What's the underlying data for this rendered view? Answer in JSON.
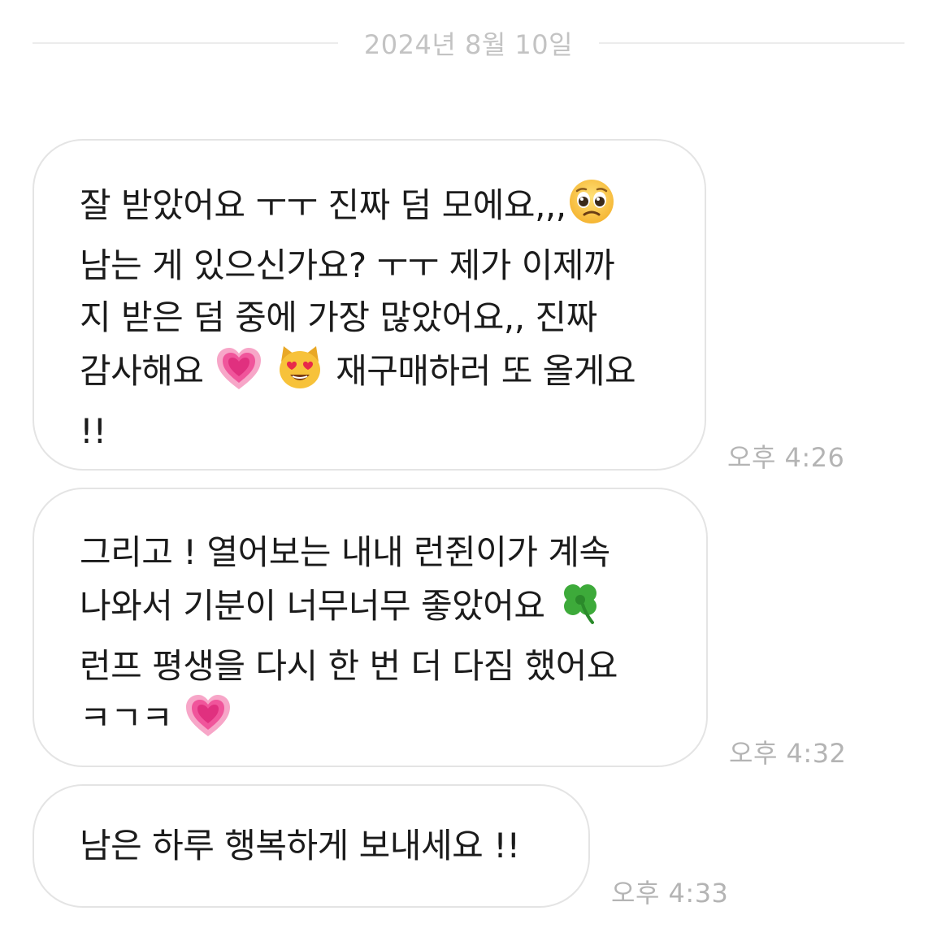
{
  "date_divider": "2024년 8월 10일",
  "messages": [
    {
      "lines": {
        "l1": "잘 받았어요 ㅜㅜ 진짜 덤 모에요,,,",
        "l2": "남는 게 있으신가요? ㅜㅜ 제가 이제까",
        "l3": "지 받은 덤 중에 가장 많았어요,, 진짜",
        "l4a": "감사해요",
        "l4b": "재구매하러 또 올게요",
        "l5": "!!"
      },
      "emojis": [
        "pleading-face",
        "growing-heart",
        "heart-eyes-cat"
      ],
      "time": "오후 4:26"
    },
    {
      "lines": {
        "l1": "그리고 ! 열어보는 내내 런쥔이가 계속",
        "l2": "나와서 기분이 너무너무 좋았어요",
        "l3": "런프 평생을 다시 한 번 더 다짐 했어요",
        "l4": "ㅋㄱㅋ"
      },
      "emojis": [
        "four-leaf-clover",
        "growing-heart"
      ],
      "time": "오후 4:32"
    },
    {
      "lines": {
        "l1": "남은 하루 행복하게 보내세요 !!"
      },
      "emojis": [],
      "time": "오후 4:33"
    }
  ],
  "colors": {
    "bubble_border": "#e4e4e4",
    "message_text": "#1b1b1b",
    "timestamp": "#b4b4b4",
    "date_text": "#c3c3c3",
    "heart_pink": "#f0559b",
    "cat_yellow": "#f7c23a",
    "clover_green": "#3daa3a"
  }
}
